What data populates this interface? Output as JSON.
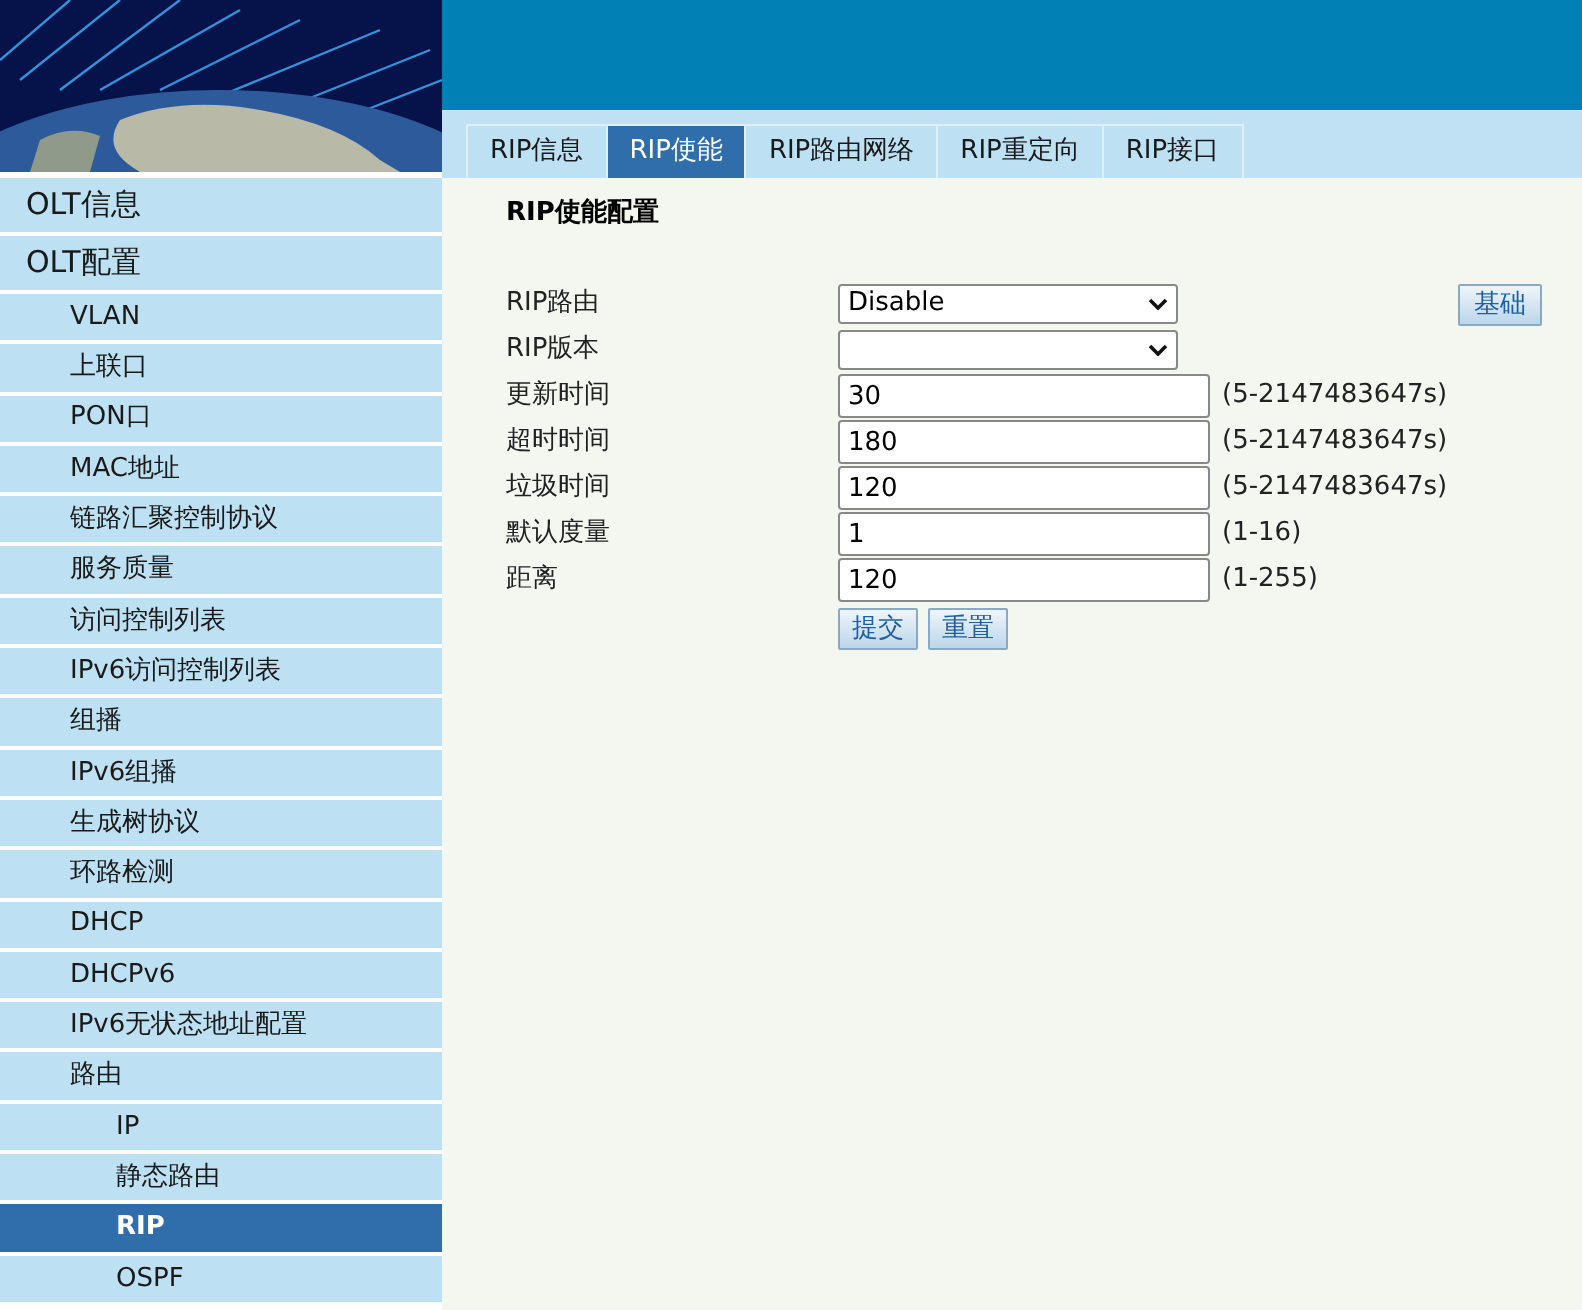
{
  "sidebar": {
    "items": [
      {
        "label": "OLT信息",
        "selected": false
      },
      {
        "label": "OLT配置",
        "selected": false,
        "children": [
          {
            "label": "VLAN",
            "selected": false
          },
          {
            "label": "上联口",
            "selected": false
          },
          {
            "label": "PON口",
            "selected": false
          },
          {
            "label": "MAC地址",
            "selected": false
          },
          {
            "label": "链路汇聚控制协议",
            "selected": false
          },
          {
            "label": "服务质量",
            "selected": false
          },
          {
            "label": "访问控制列表",
            "selected": false
          },
          {
            "label": "IPv6访问控制列表",
            "selected": false
          },
          {
            "label": "组播",
            "selected": false
          },
          {
            "label": "IPv6组播",
            "selected": false
          },
          {
            "label": "生成树协议",
            "selected": false
          },
          {
            "label": "环路检测",
            "selected": false
          },
          {
            "label": "DHCP",
            "selected": false
          },
          {
            "label": "DHCPv6",
            "selected": false
          },
          {
            "label": "IPv6无状态地址配置",
            "selected": false
          },
          {
            "label": "路由",
            "selected": false,
            "children": [
              {
                "label": "IP",
                "selected": false
              },
              {
                "label": "静态路由",
                "selected": false
              },
              {
                "label": "RIP",
                "selected": true
              },
              {
                "label": "OSPF",
                "selected": false
              }
            ]
          }
        ]
      }
    ]
  },
  "tabs": [
    {
      "label": "RIP信息",
      "selected": false
    },
    {
      "label": "RIP使能",
      "selected": true
    },
    {
      "label": "RIP路由网络",
      "selected": false
    },
    {
      "label": "RIP重定向",
      "selected": false
    },
    {
      "label": "RIP接口",
      "selected": false
    }
  ],
  "section_title": "RIP使能配置",
  "form": {
    "rows": [
      {
        "label": "RIP路由",
        "kind": "select",
        "value": "Disable"
      },
      {
        "label": "RIP版本",
        "kind": "select"
      },
      {
        "label": "更新时间",
        "kind": "input",
        "value": "30",
        "range": "(5-2147483647s)"
      },
      {
        "label": "超时时间",
        "kind": "input",
        "value": "180",
        "range": "(5-2147483647s)"
      },
      {
        "label": "垃圾时间",
        "kind": "input",
        "value": "120",
        "range": "(5-2147483647s)"
      },
      {
        "label": "默认度量",
        "kind": "input",
        "value": "1",
        "range": "(1-16)"
      },
      {
        "label": "距离",
        "kind": "input",
        "value": "120",
        "range": "(1-255)"
      }
    ],
    "buttons": [
      "提交",
      "重置"
    ]
  },
  "basic_button": "基础"
}
